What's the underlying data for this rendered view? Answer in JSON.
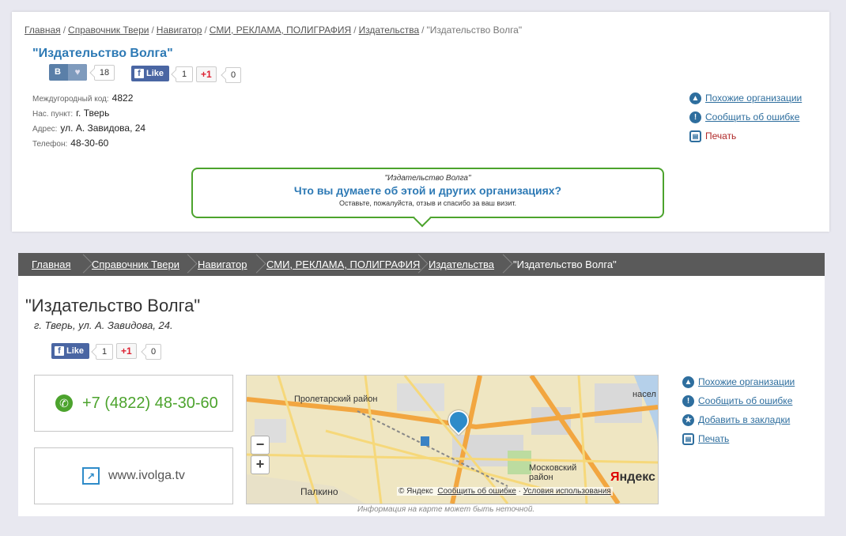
{
  "top": {
    "breadcrumbs": [
      "Главная",
      "Справочник Твери",
      "Навигатор",
      "СМИ, РЕКЛАМА, ПОЛИГРАФИЯ",
      "Издательства"
    ],
    "breadcrumb_current": "\"Издательство Волга\"",
    "title": "\"Издательство Волга\"",
    "vk": {
      "label": "В",
      "count": "18"
    },
    "fb": {
      "label": "Like",
      "count": "1"
    },
    "gplus": {
      "label": "+1",
      "count": "0"
    },
    "info": [
      {
        "label": "Междугородный код:",
        "value": "4822"
      },
      {
        "label": "Нас. пункт:",
        "value": "г. Тверь"
      },
      {
        "label": "Адрес:",
        "value": "ул. А. Завидова, 24"
      },
      {
        "label": "Телефон:",
        "value": "48-30-60"
      }
    ],
    "side_links": [
      "Похожие организации",
      "Сообщить об ошибке",
      "Печать"
    ],
    "bubble": {
      "org": "\"Издательство Волга\"",
      "question": "Что вы думаете об этой и других организациях?",
      "note": "Оставьте, пожалуйста, отзыв и спасибо за ваш визит."
    }
  },
  "bottom": {
    "breadcrumbs": [
      "Главная",
      "Справочник Твери",
      "Навигатор",
      "СМИ, РЕКЛАМА, ПОЛИГРАФИЯ",
      "Издательства"
    ],
    "breadcrumb_current": "\"Издательство Волга\"",
    "title": "\"Издательство Волга\"",
    "address": "г. Тверь, ул. А. Завидова, 24.",
    "fb": {
      "label": "Like",
      "count": "1"
    },
    "gplus": {
      "label": "+1",
      "count": "0"
    },
    "phone": "+7 (4822) 48-30-60",
    "website": "www.ivolga.tv",
    "map": {
      "labels": [
        "Пролетарский район",
        "Московский район",
        "Палкино",
        "насел"
      ],
      "zoom_out": "−",
      "zoom_in": "+",
      "logo_prefix": "Я",
      "logo_rest": "ндекс",
      "copyright": "© Яндекс",
      "report_error": "Сообщить об ошибке",
      "terms": "Условия использования"
    },
    "side_links": [
      "Похожие организации",
      "Сообщить об ошибке",
      "Добавить в закладки",
      "Печать"
    ],
    "map_note": "Информация на карте может быть неточной."
  }
}
